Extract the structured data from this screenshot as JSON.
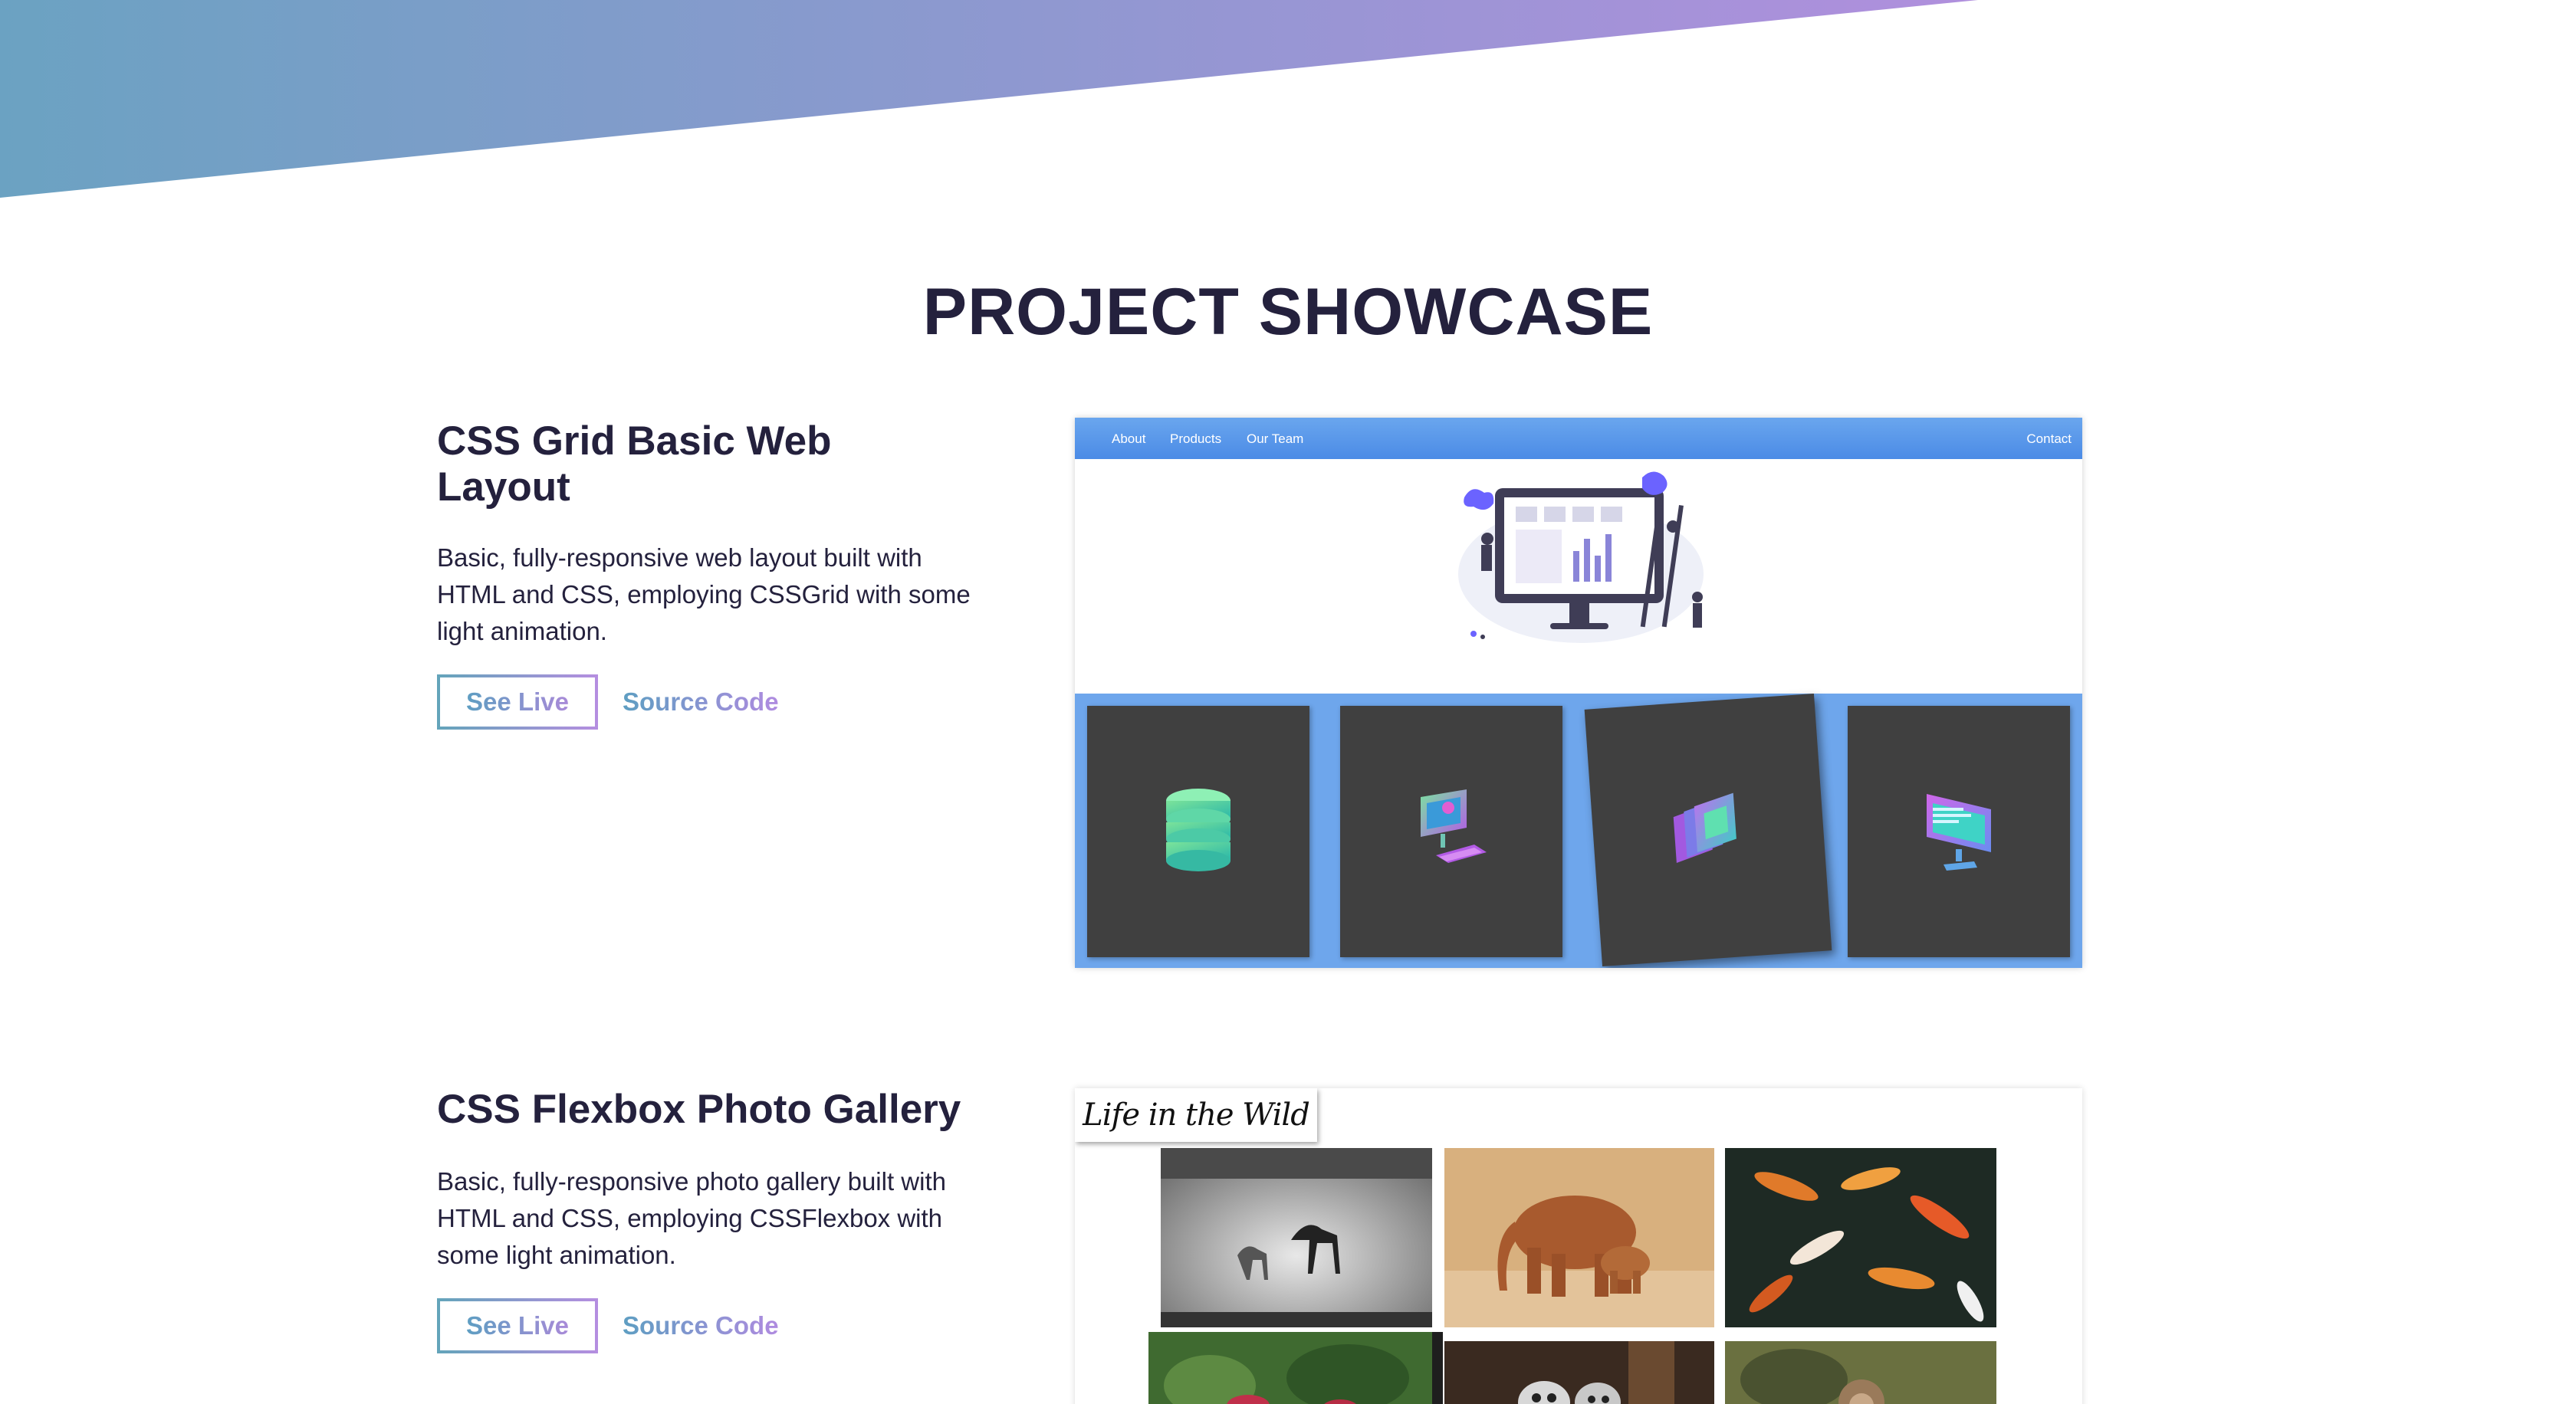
{
  "section": {
    "title": "PROJECT SHOWCASE"
  },
  "projects": [
    {
      "title": "CSS Grid Basic Web Layout",
      "description": "Basic, fully-responsive web layout built with HTML and CSS, employing CSSGrid with some light animation.",
      "live_label": "See Live",
      "source_label": "Source Code",
      "preview": {
        "nav": {
          "about": "About",
          "products": "Products",
          "team": "Our Team",
          "contact": "Contact"
        },
        "cards": [
          "database-icon",
          "computer-icon",
          "layers-icon",
          "monitor-icon"
        ]
      }
    },
    {
      "title": "CSS Flexbox Photo Gallery",
      "description": "Basic, fully-responsive photo gallery built with HTML and CSS, employing CSSFlexbox with some light animation.",
      "live_label": "See Live",
      "source_label": "Source Code",
      "preview": {
        "heading": "Life in the Wild",
        "photos": [
          "horses-photo",
          "elephants-photo",
          "koi-fish-photo",
          "birds-photo",
          "lemurs-photo",
          "monkey-photo"
        ]
      }
    }
  ],
  "colors": {
    "heading": "#24213d",
    "gradient_start": "#6aa3c2",
    "gradient_end": "#b28ee0",
    "preview_nav": "#5593e8",
    "card_bg": "#404040"
  }
}
